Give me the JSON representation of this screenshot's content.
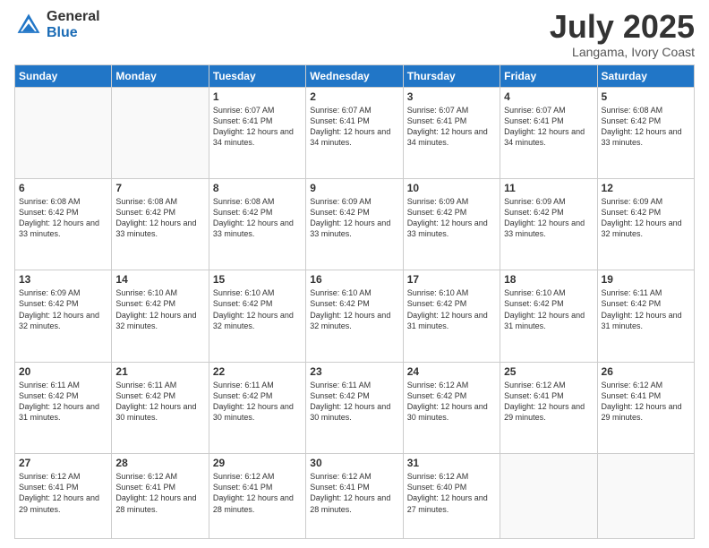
{
  "logo": {
    "general": "General",
    "blue": "Blue"
  },
  "title": "July 2025",
  "location": "Langama, Ivory Coast",
  "days_of_week": [
    "Sunday",
    "Monday",
    "Tuesday",
    "Wednesday",
    "Thursday",
    "Friday",
    "Saturday"
  ],
  "weeks": [
    [
      {
        "day": "",
        "info": ""
      },
      {
        "day": "",
        "info": ""
      },
      {
        "day": "1",
        "info": "Sunrise: 6:07 AM\nSunset: 6:41 PM\nDaylight: 12 hours and 34 minutes."
      },
      {
        "day": "2",
        "info": "Sunrise: 6:07 AM\nSunset: 6:41 PM\nDaylight: 12 hours and 34 minutes."
      },
      {
        "day": "3",
        "info": "Sunrise: 6:07 AM\nSunset: 6:41 PM\nDaylight: 12 hours and 34 minutes."
      },
      {
        "day": "4",
        "info": "Sunrise: 6:07 AM\nSunset: 6:41 PM\nDaylight: 12 hours and 34 minutes."
      },
      {
        "day": "5",
        "info": "Sunrise: 6:08 AM\nSunset: 6:42 PM\nDaylight: 12 hours and 33 minutes."
      }
    ],
    [
      {
        "day": "6",
        "info": "Sunrise: 6:08 AM\nSunset: 6:42 PM\nDaylight: 12 hours and 33 minutes."
      },
      {
        "day": "7",
        "info": "Sunrise: 6:08 AM\nSunset: 6:42 PM\nDaylight: 12 hours and 33 minutes."
      },
      {
        "day": "8",
        "info": "Sunrise: 6:08 AM\nSunset: 6:42 PM\nDaylight: 12 hours and 33 minutes."
      },
      {
        "day": "9",
        "info": "Sunrise: 6:09 AM\nSunset: 6:42 PM\nDaylight: 12 hours and 33 minutes."
      },
      {
        "day": "10",
        "info": "Sunrise: 6:09 AM\nSunset: 6:42 PM\nDaylight: 12 hours and 33 minutes."
      },
      {
        "day": "11",
        "info": "Sunrise: 6:09 AM\nSunset: 6:42 PM\nDaylight: 12 hours and 33 minutes."
      },
      {
        "day": "12",
        "info": "Sunrise: 6:09 AM\nSunset: 6:42 PM\nDaylight: 12 hours and 32 minutes."
      }
    ],
    [
      {
        "day": "13",
        "info": "Sunrise: 6:09 AM\nSunset: 6:42 PM\nDaylight: 12 hours and 32 minutes."
      },
      {
        "day": "14",
        "info": "Sunrise: 6:10 AM\nSunset: 6:42 PM\nDaylight: 12 hours and 32 minutes."
      },
      {
        "day": "15",
        "info": "Sunrise: 6:10 AM\nSunset: 6:42 PM\nDaylight: 12 hours and 32 minutes."
      },
      {
        "day": "16",
        "info": "Sunrise: 6:10 AM\nSunset: 6:42 PM\nDaylight: 12 hours and 32 minutes."
      },
      {
        "day": "17",
        "info": "Sunrise: 6:10 AM\nSunset: 6:42 PM\nDaylight: 12 hours and 31 minutes."
      },
      {
        "day": "18",
        "info": "Sunrise: 6:10 AM\nSunset: 6:42 PM\nDaylight: 12 hours and 31 minutes."
      },
      {
        "day": "19",
        "info": "Sunrise: 6:11 AM\nSunset: 6:42 PM\nDaylight: 12 hours and 31 minutes."
      }
    ],
    [
      {
        "day": "20",
        "info": "Sunrise: 6:11 AM\nSunset: 6:42 PM\nDaylight: 12 hours and 31 minutes."
      },
      {
        "day": "21",
        "info": "Sunrise: 6:11 AM\nSunset: 6:42 PM\nDaylight: 12 hours and 30 minutes."
      },
      {
        "day": "22",
        "info": "Sunrise: 6:11 AM\nSunset: 6:42 PM\nDaylight: 12 hours and 30 minutes."
      },
      {
        "day": "23",
        "info": "Sunrise: 6:11 AM\nSunset: 6:42 PM\nDaylight: 12 hours and 30 minutes."
      },
      {
        "day": "24",
        "info": "Sunrise: 6:12 AM\nSunset: 6:42 PM\nDaylight: 12 hours and 30 minutes."
      },
      {
        "day": "25",
        "info": "Sunrise: 6:12 AM\nSunset: 6:41 PM\nDaylight: 12 hours and 29 minutes."
      },
      {
        "day": "26",
        "info": "Sunrise: 6:12 AM\nSunset: 6:41 PM\nDaylight: 12 hours and 29 minutes."
      }
    ],
    [
      {
        "day": "27",
        "info": "Sunrise: 6:12 AM\nSunset: 6:41 PM\nDaylight: 12 hours and 29 minutes."
      },
      {
        "day": "28",
        "info": "Sunrise: 6:12 AM\nSunset: 6:41 PM\nDaylight: 12 hours and 28 minutes."
      },
      {
        "day": "29",
        "info": "Sunrise: 6:12 AM\nSunset: 6:41 PM\nDaylight: 12 hours and 28 minutes."
      },
      {
        "day": "30",
        "info": "Sunrise: 6:12 AM\nSunset: 6:41 PM\nDaylight: 12 hours and 28 minutes."
      },
      {
        "day": "31",
        "info": "Sunrise: 6:12 AM\nSunset: 6:40 PM\nDaylight: 12 hours and 27 minutes."
      },
      {
        "day": "",
        "info": ""
      },
      {
        "day": "",
        "info": ""
      }
    ]
  ]
}
